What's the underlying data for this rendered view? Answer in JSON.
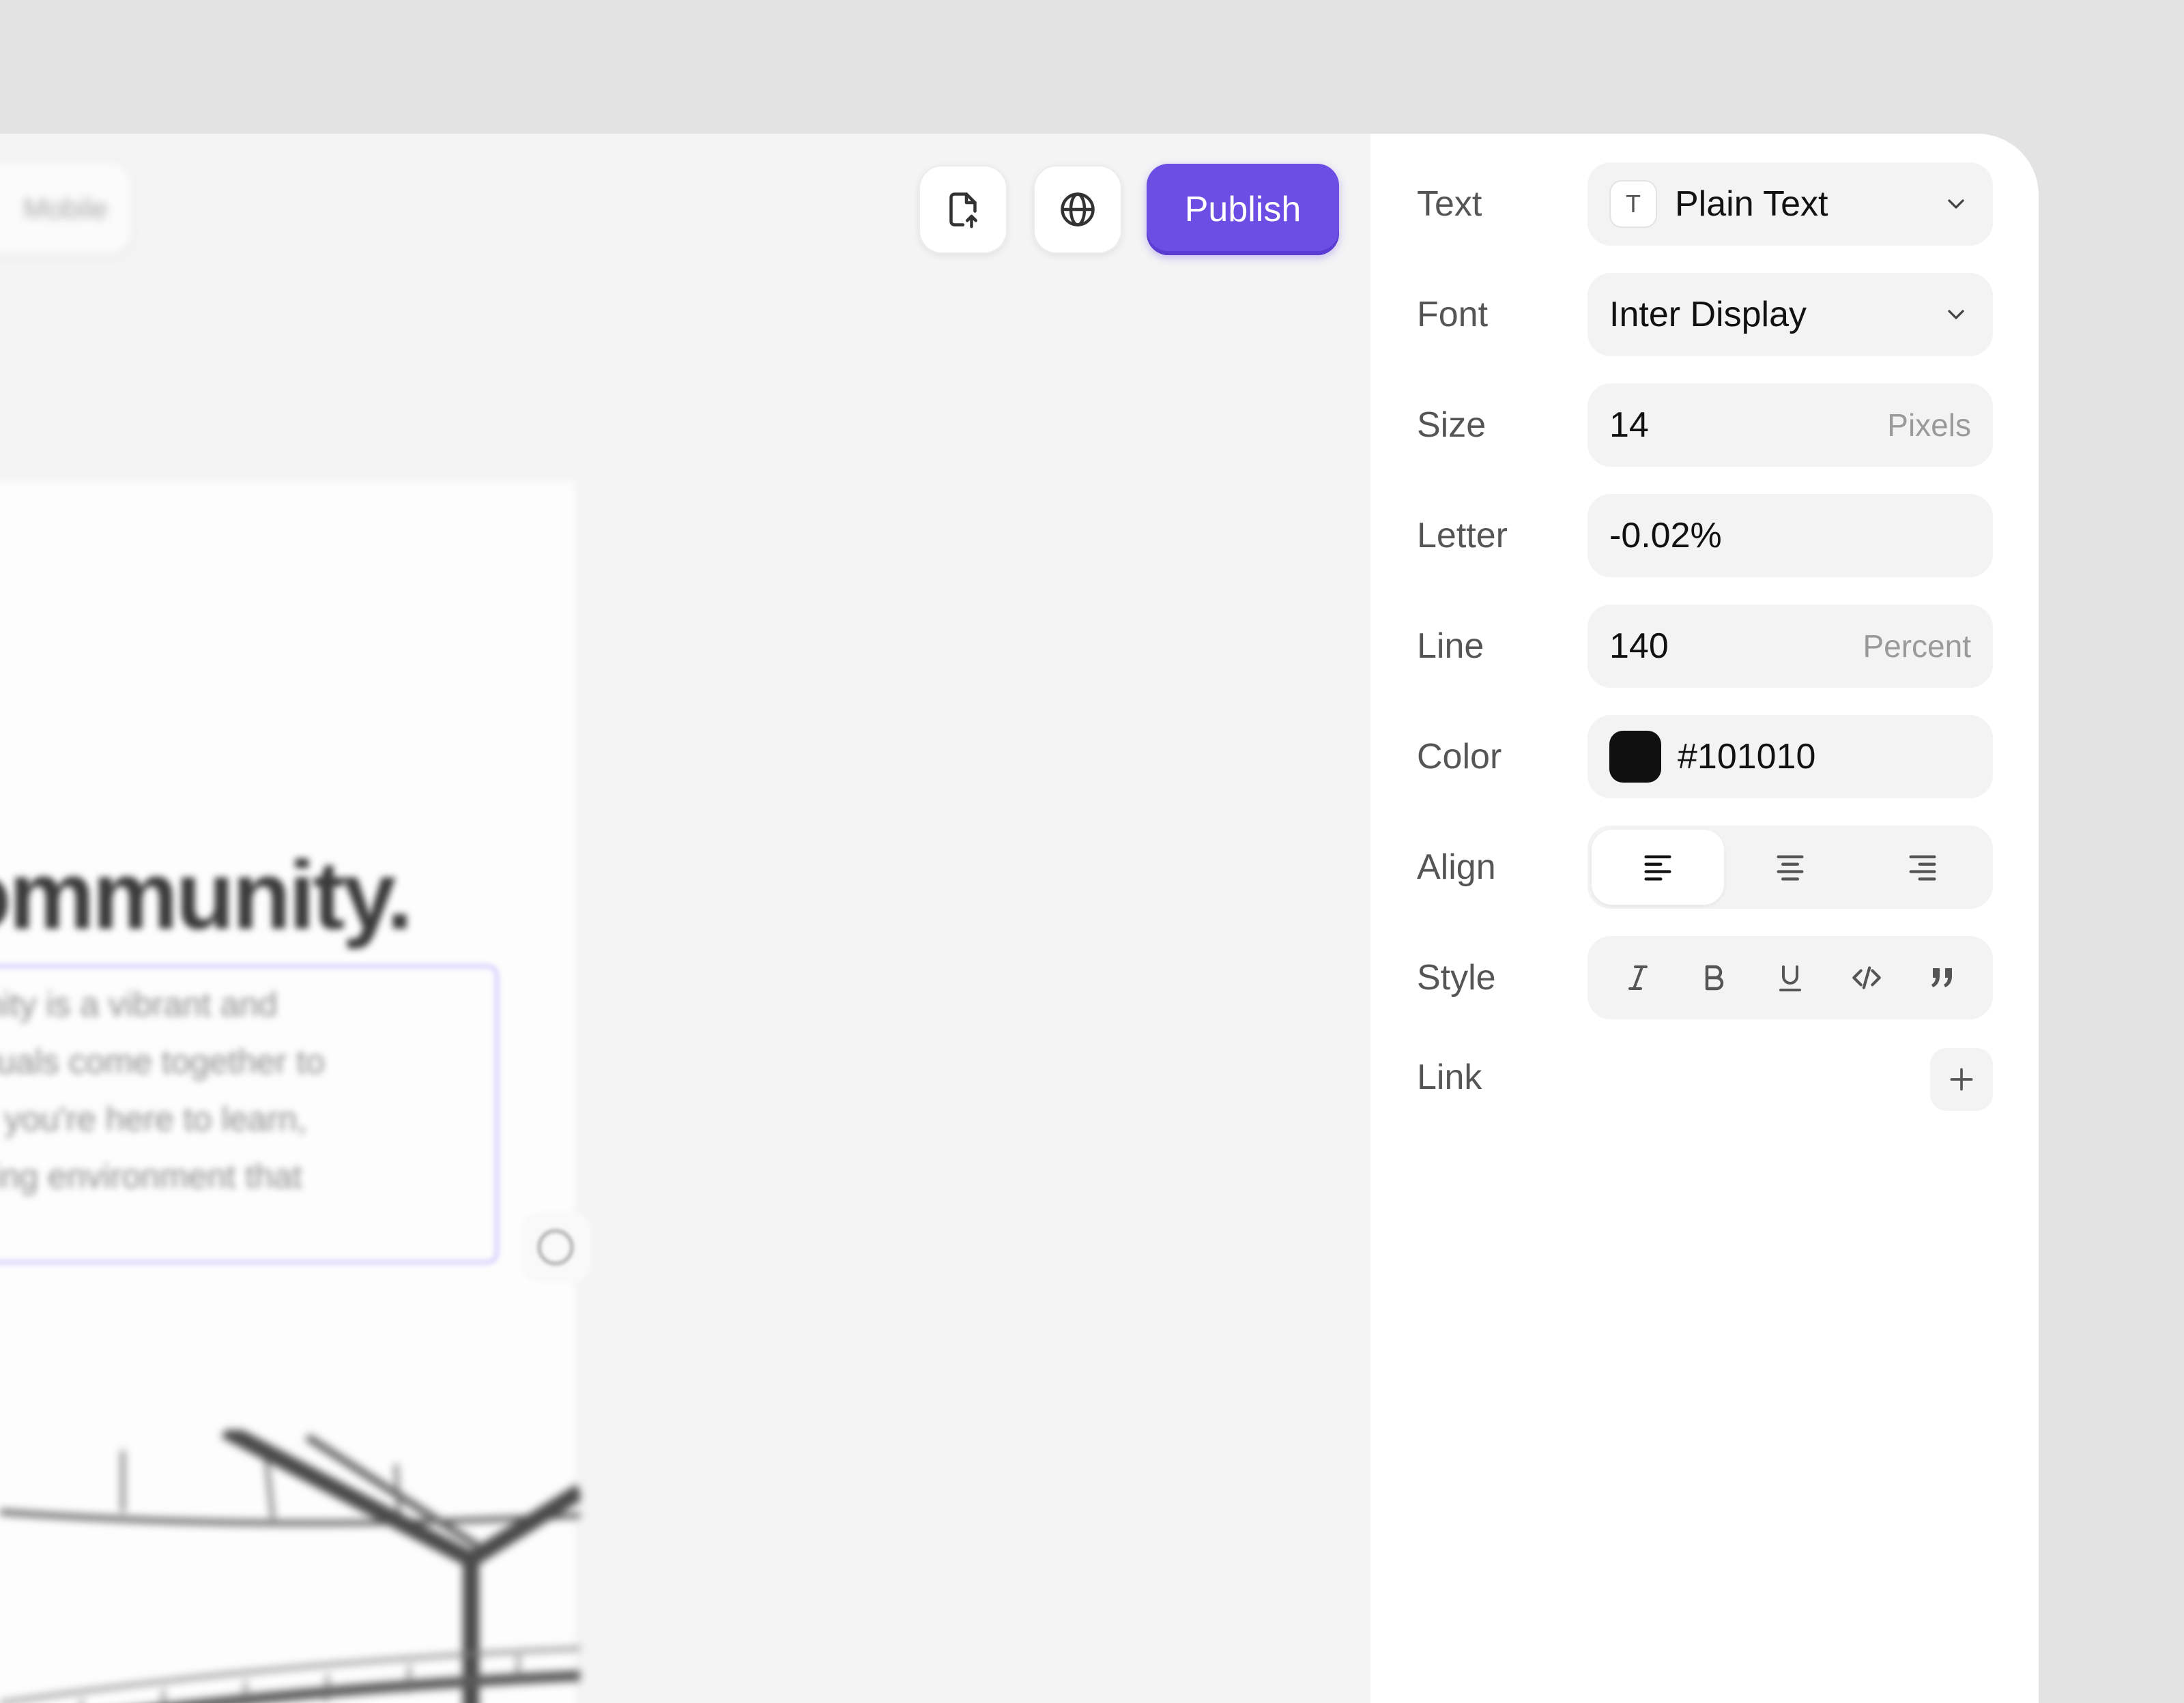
{
  "toolbar": {
    "device_label": "Mobile",
    "publish_label": "Publish",
    "icons": [
      "file-upload-icon",
      "globe-icon"
    ]
  },
  "canvas": {
    "hero_fragment": "ommunity.",
    "body_lines": [
      "nunity is a vibrant and",
      "ividuals come together to",
      "her you're here to learn,",
      "oming environment that"
    ]
  },
  "panel": {
    "text": {
      "label": "Text",
      "badge": "T",
      "value": "Plain Text"
    },
    "font": {
      "label": "Font",
      "value": "Inter Display"
    },
    "size": {
      "label": "Size",
      "value": "14",
      "unit": "Pixels"
    },
    "letter": {
      "label": "Letter",
      "value": "-0.02%"
    },
    "line": {
      "label": "Line",
      "value": "140",
      "unit": "Percent"
    },
    "color": {
      "label": "Color",
      "value": "#101010",
      "swatch": "#101010"
    },
    "align": {
      "label": "Align",
      "options": [
        "align-left-icon",
        "align-center-icon",
        "align-right-icon"
      ],
      "active": "align-left-icon"
    },
    "style": {
      "label": "Style",
      "options": [
        "italic-icon",
        "bold-icon",
        "underline-icon",
        "code-icon",
        "quote-icon"
      ]
    },
    "link": {
      "label": "Link"
    }
  },
  "colors": {
    "accent": "#6c4ee4",
    "selection": "#c8b9ff"
  }
}
